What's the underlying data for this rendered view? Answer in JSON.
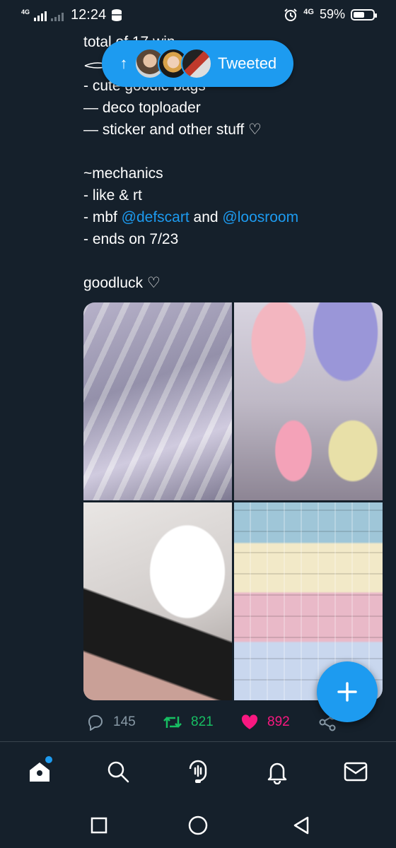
{
  "status_bar": {
    "network_left": "4G",
    "time": "12:24",
    "network_right": "4G",
    "battery": "59%",
    "battery_level": 0.59
  },
  "tweet": {
    "lines": [
      "total of 17 win",
      "",
      "- cute goodie bags",
      "— deco toploader",
      "— sticker and other stuff ♡",
      "",
      "~mechanics",
      "- like & rt",
      "",
      "- ends on 7/23",
      "",
      "goodluck ♡"
    ],
    "mbf_prefix": "- mbf ",
    "mention_1": "@defscart",
    "mbf_and": " and ",
    "mention_2": "@loosroom"
  },
  "tweeted_pill": {
    "label": "Tweeted",
    "icon": "arrow-up-icon"
  },
  "actions": {
    "reply_count": "145",
    "retweet_count": "821",
    "like_count": "892"
  },
  "colors": {
    "background": "#15202b",
    "accent": "#1d9bf0",
    "retweet": "#17bf63",
    "like": "#f91880",
    "muted": "#8899a6"
  },
  "bottom_nav": [
    "home-icon",
    "search-icon",
    "spaces-icon",
    "notifications-icon",
    "messages-icon"
  ],
  "system_nav": [
    "recents-icon",
    "home-circle-icon",
    "back-icon"
  ]
}
